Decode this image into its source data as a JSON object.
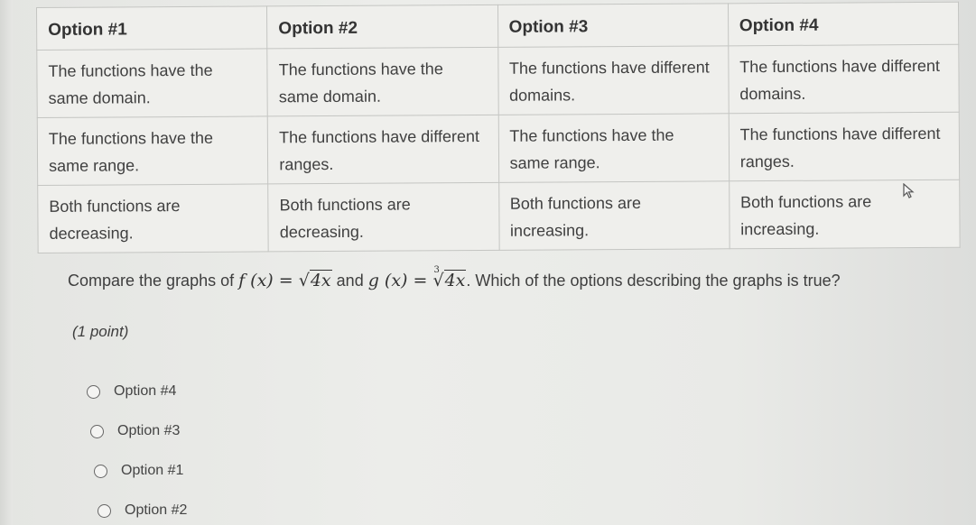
{
  "table": {
    "headers": [
      "Option #1",
      "Option #2",
      "Option #3",
      "Option #4"
    ],
    "rows": [
      [
        "The functions have the same domain.",
        "The functions have the same domain.",
        "The functions have different domains.",
        "The functions have different domains."
      ],
      [
        "The functions have the same range.",
        "The functions have different ranges.",
        "The functions have the same range.",
        "The functions have different ranges."
      ],
      [
        "Both functions are decreasing.",
        "Both functions are decreasing.",
        "Both functions are increasing.",
        "Both functions are increasing."
      ]
    ]
  },
  "question": {
    "prefix": "Compare the graphs of ",
    "f_label": "f (x) = ",
    "f_radicand": "4x",
    "conjunction": " and ",
    "g_label": "g (x) = ",
    "g_index": "3",
    "g_radicand": "4x",
    "suffix": ". Which of the options describing the graphs is true?"
  },
  "points": "(1 point)",
  "choices": [
    {
      "label": "Option #4",
      "selected": false
    },
    {
      "label": "Option #3",
      "selected": false
    },
    {
      "label": "Option #1",
      "selected": false
    },
    {
      "label": "Option #2",
      "selected": false
    }
  ],
  "icons": {
    "cursor": "mouse-pointer-icon"
  }
}
